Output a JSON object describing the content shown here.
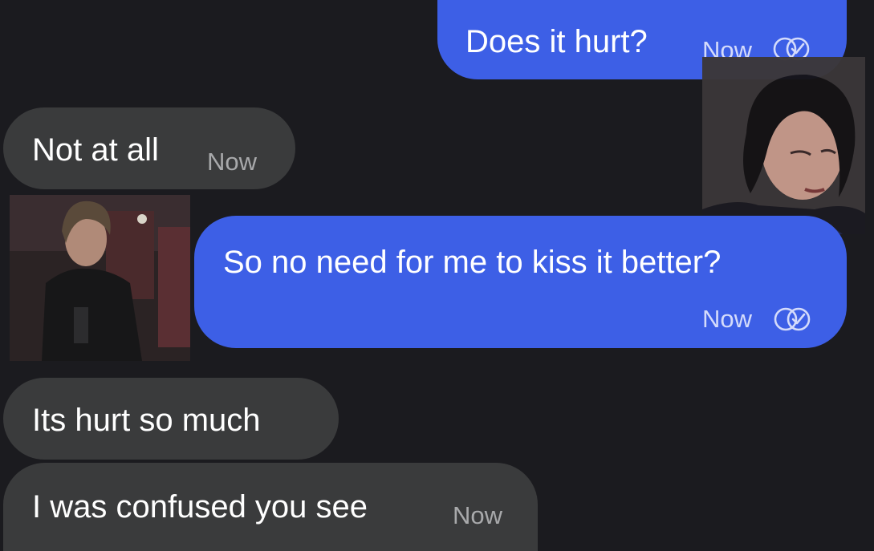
{
  "messages": [
    {
      "id": "m1",
      "direction": "outgoing",
      "text": "Does it hurt?",
      "time": "Now",
      "receipt": "read-receipt-icon"
    },
    {
      "id": "m2",
      "direction": "incoming",
      "text": "Not at all",
      "time": "Now"
    },
    {
      "id": "m3",
      "direction": "outgoing",
      "text": "So no need for me to kiss it better?",
      "time": "Now",
      "receipt": "read-receipt-icon"
    },
    {
      "id": "m4",
      "direction": "incoming",
      "text": "Its hurt so much"
    },
    {
      "id": "m5",
      "direction": "incoming",
      "text": "I was confused you see",
      "time": "Now"
    }
  ],
  "colors": {
    "background": "#1b1b1f",
    "outgoing_bubble": "#3d5fe6",
    "incoming_bubble": "#3a3b3c",
    "text": "#ffffff"
  },
  "avatars": {
    "outgoing": "avatar-dark-bob-hair-woman",
    "incoming": "avatar-man-tactical-gear"
  }
}
